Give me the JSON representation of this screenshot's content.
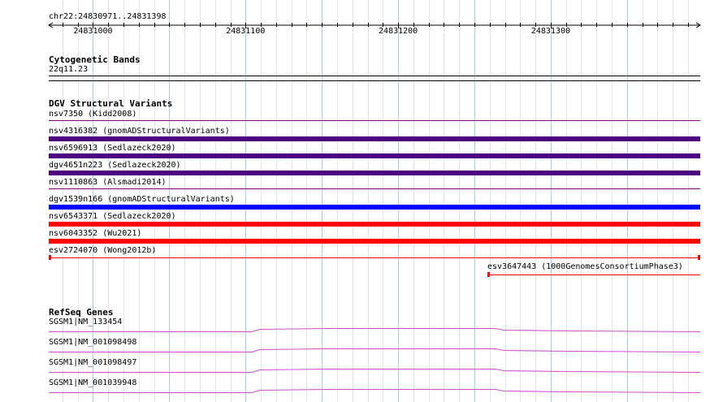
{
  "region_label": "chr22:24830971..24831398",
  "ruler": {
    "start": 24830971,
    "end": 24831398,
    "tick_labels": [
      "24831000",
      "24831100",
      "24831200",
      "24831300"
    ]
  },
  "colors": {
    "grid_major": "#a8cce2",
    "grid_minor": "#d6e8f2",
    "variant_outline": "#800080",
    "variant_dark": "#4b0082",
    "variant_blue": "#0000ff",
    "variant_red": "#ff0000",
    "gene": "#d14bd1"
  },
  "cyto": {
    "title": "Cytogenetic Bands",
    "band": "22q11.23"
  },
  "dgv": {
    "title": "DGV Structural Variants",
    "variants": [
      {
        "label": "nsv7350 (Kidd2008)",
        "style": "outline"
      },
      {
        "label": "nsv4316382 (gnomADStructuralVariants)",
        "style": "dark"
      },
      {
        "label": "nsv6596913 (Sedlazeck2020)",
        "style": "dark"
      },
      {
        "label": "dgv4651n223 (Sedlazeck2020)",
        "style": "dark"
      },
      {
        "label": "nsv1110863 (Alsmadi2014)",
        "style": "outline"
      },
      {
        "label": "dgv1539n166 (gnomADStructuralVariants)",
        "style": "blue"
      },
      {
        "label": "nsv6543371 (Sedlazeck2020)",
        "style": "red"
      },
      {
        "label": "nsv6043352 (Wu2021)",
        "style": "red"
      },
      {
        "label": "esv2724070 (Wong2012b)",
        "style": "thinred"
      }
    ],
    "extra": {
      "label": "esv3647443 (1000GenomesConsortiumPhase3)"
    }
  },
  "refseq": {
    "title": "RefSeq Genes",
    "genes": [
      {
        "label": "SGSM1|NM_133454"
      },
      {
        "label": "SGSM1|NM_001098498"
      },
      {
        "label": "SGSM1|NM_001098497"
      },
      {
        "label": "SGSM1|NM_001039948"
      }
    ]
  }
}
